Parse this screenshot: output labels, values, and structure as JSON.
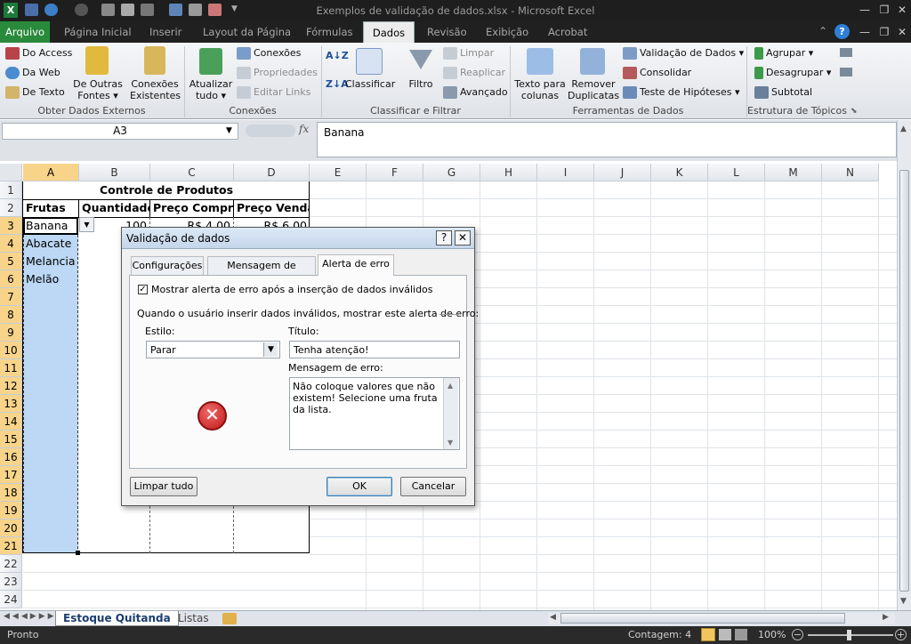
{
  "app": {
    "title": "Exemplos de validação de dados.xlsx  -  Microsoft Excel",
    "accent_file_tab": "#2a8a3b",
    "selected_header_color": "#f7d48a",
    "selection_fill": "#bcd8f4"
  },
  "ribbon_tabs": [
    "Arquivo",
    "Página Inicial",
    "Inserir",
    "Layout da Página",
    "Fórmulas",
    "Dados",
    "Revisão",
    "Exibição",
    "Acrobat"
  ],
  "active_tab": "Dados",
  "ribbon": {
    "g1": {
      "label": "Obter Dados Externos",
      "access": "Do Access",
      "web": "Da Web",
      "text": "De Texto",
      "other1": "De Outras",
      "other2": "Fontes ▾",
      "conn1": "Conexões",
      "conn2": "Existentes"
    },
    "g2": {
      "label": "Conexões",
      "refresh1": "Atualizar",
      "refresh2": "tudo ▾",
      "connections": "Conexões",
      "properties": "Propriedades",
      "edit_links": "Editar Links"
    },
    "g3": {
      "label": "Classificar e Filtrar",
      "sort": "Classificar",
      "filter": "Filtro",
      "clear": "Limpar",
      "reapply": "Reaplicar",
      "advanced": "Avançado"
    },
    "g4": {
      "label": "Ferramentas de Dados",
      "t2c1": "Texto para",
      "t2c2": "colunas",
      "rd1": "Remover",
      "rd2": "Duplicatas",
      "validation": "Validação de Dados",
      "consolidate": "Consolidar",
      "whatif": "Teste de Hipóteses"
    },
    "g5": {
      "label": "Estrutura de Tópicos",
      "group": "Agrupar",
      "ungroup": "Desagrupar",
      "subtotal": "Subtotal"
    }
  },
  "formula_bar": {
    "name_box": "A3",
    "fx": "fx",
    "value": "Banana"
  },
  "columns": [
    "A",
    "B",
    "C",
    "D",
    "E",
    "F",
    "G",
    "H",
    "I",
    "J",
    "K",
    "L",
    "M",
    "N"
  ],
  "rows": [
    "1",
    "2",
    "3",
    "4",
    "5",
    "6",
    "7",
    "8",
    "9",
    "10",
    "11",
    "12",
    "13",
    "14",
    "15",
    "16",
    "17",
    "18",
    "19",
    "20",
    "21",
    "22",
    "23",
    "24"
  ],
  "cells": {
    "title": "Controle de Produtos",
    "headers": [
      "Frutas",
      "Quantidade",
      "Preço Compra",
      "Preço Venda"
    ],
    "fruits": [
      "Banana",
      "Abacate",
      "Melancia",
      "Melão"
    ],
    "b3": "100",
    "c3": "R$ 4,00",
    "d3": "R$ 6,00"
  },
  "sheet_tabs": [
    "Estoque Quitanda",
    "Listas"
  ],
  "active_sheet": "Estoque Quitanda",
  "status": {
    "ready": "Pronto",
    "count": "Contagem: 4",
    "zoom": "100%"
  },
  "dialog": {
    "title": "Validação de dados",
    "tabs": [
      "Configurações",
      "Mensagem de entrada",
      "Alerta de erro"
    ],
    "active_tab": "Alerta de erro",
    "show_alert_label": "Mostrar alerta de erro após a inserção de dados inválidos",
    "show_alert_checked": true,
    "section_label": "Quando o usuário inserir dados inválidos, mostrar este alerta de erro:",
    "style_label": "Estilo:",
    "style_value": "Parar",
    "title_label": "Título:",
    "title_value": "Tenha atenção!",
    "message_label": "Mensagem de erro:",
    "message_value": "Não coloque valores que não existem! Selecione uma fruta da lista.",
    "clear_all": "Limpar tudo",
    "ok": "OK",
    "cancel": "Cancelar"
  }
}
